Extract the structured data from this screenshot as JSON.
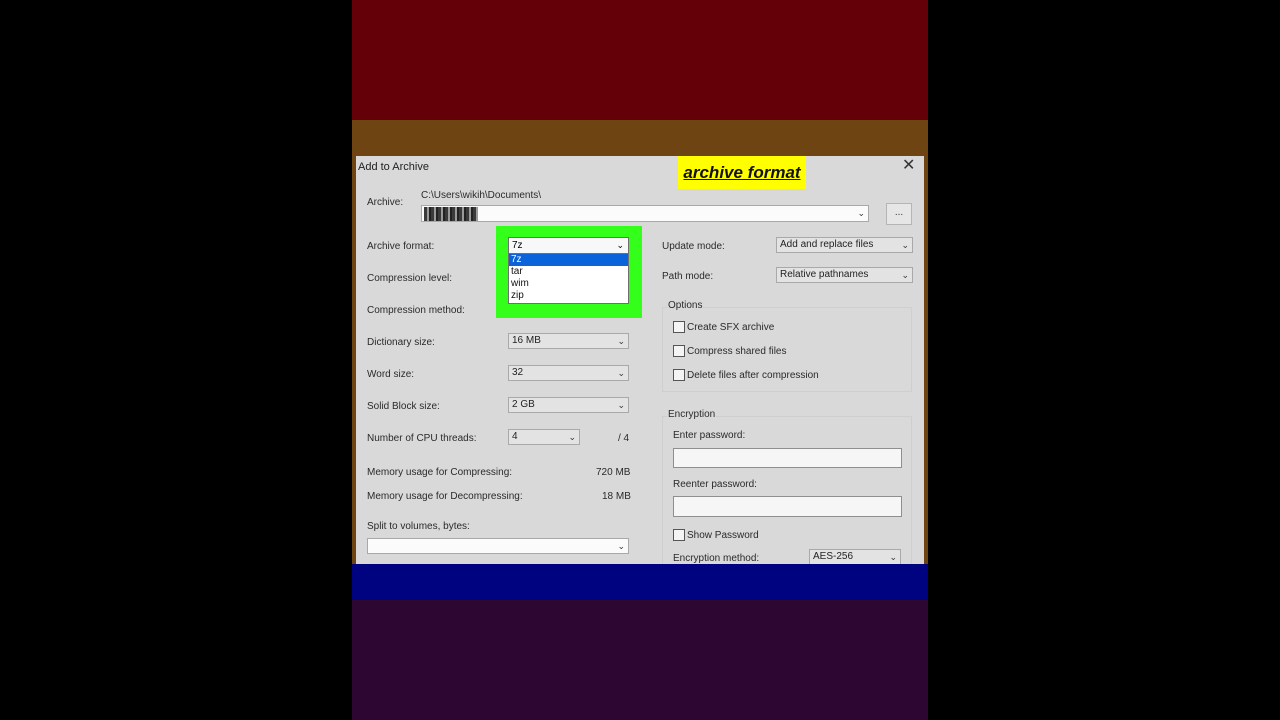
{
  "dialog": {
    "title": "Add to Archive",
    "close_glyph": "✕",
    "annotation": "archive format"
  },
  "archive": {
    "label": "Archive:",
    "path": "C:\\Users\\wikih\\Documents\\",
    "browse_label": "..."
  },
  "left": {
    "archive_format": {
      "label": "Archive format:",
      "value": "7z",
      "options": [
        "7z",
        "tar",
        "wim",
        "zip"
      ],
      "selected_index": 0
    },
    "compression_level": {
      "label": "Compression level:"
    },
    "compression_method": {
      "label": "Compression method:"
    },
    "dictionary_size": {
      "label": "Dictionary size:",
      "value": "16 MB"
    },
    "word_size": {
      "label": "Word size:",
      "value": "32"
    },
    "solid_block_size": {
      "label": "Solid Block size:",
      "value": "2 GB"
    },
    "cpu_threads": {
      "label": "Number of CPU threads:",
      "value": "4",
      "max": "/ 4"
    },
    "mem_compress": {
      "label": "Memory usage for Compressing:",
      "value": "720 MB"
    },
    "mem_decompress": {
      "label": "Memory usage for Decompressing:",
      "value": "18 MB"
    },
    "split_volumes": {
      "label": "Split to volumes, bytes:",
      "value": ""
    }
  },
  "right": {
    "update_mode": {
      "label": "Update mode:",
      "value": "Add and replace files"
    },
    "path_mode": {
      "label": "Path mode:",
      "value": "Relative pathnames"
    },
    "options": {
      "title": "Options",
      "create_sfx": "Create SFX archive",
      "compress_shared": "Compress shared files",
      "delete_after": "Delete files after compression"
    },
    "encryption": {
      "title": "Encryption",
      "enter_password": "Enter password:",
      "reenter_password": "Reenter password:",
      "show_password": "Show Password",
      "method_label": "Encryption method:",
      "method_value": "AES-256"
    }
  },
  "icons": {
    "dropdown_arrow": "⌄"
  },
  "colors": {
    "highlight": "#33ff1a",
    "badge": "#ffff00",
    "selection": "#0a63d8"
  }
}
